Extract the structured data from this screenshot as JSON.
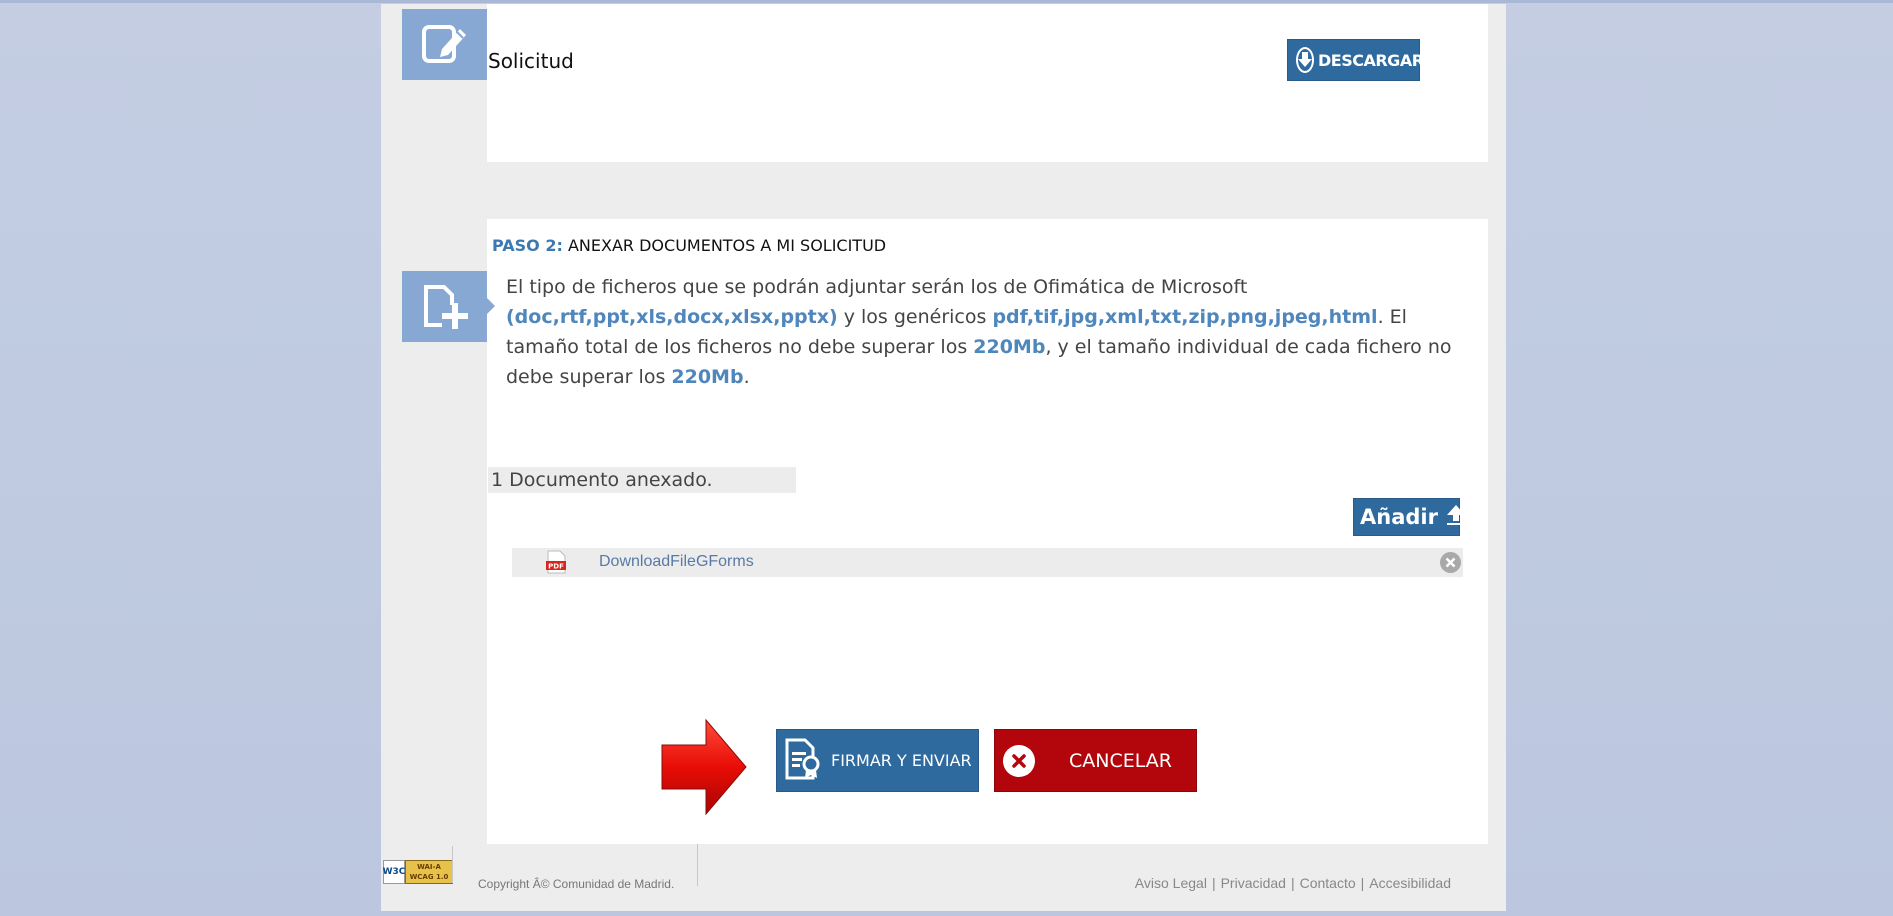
{
  "step1": {
    "title": "Solicitud",
    "download_label": "DESCARGAR"
  },
  "step2": {
    "step_label": "PASO 2:",
    "step_title": "ANEXAR DOCUMENTOS A MI SOLICITUD",
    "desc": {
      "t1": "El tipo de ficheros que se podrán adjuntar serán los de Ofimática de Microsoft ",
      "h1": "(doc,rtf,ppt,xls,docx,xlsx,pptx)",
      "t2": " y los genéricos ",
      "h2": "pdf,tif,jpg,xml,txt,zip,png,jpeg,html",
      "t3": ". El tamaño total de los ficheros no debe superar los ",
      "h3": "220Mb",
      "t4": ", y el tamaño individual de cada fichero no debe superar los ",
      "h4": "220Mb",
      "t5": "."
    },
    "doc_count": "1 Documento anexado.",
    "add_label": "Añadir",
    "files": [
      {
        "name": "DownloadFileGForms",
        "type": "PDF"
      }
    ]
  },
  "actions": {
    "sign_label": "FIRMAR Y ENVIAR",
    "cancel_label": "CANCELAR"
  },
  "footer": {
    "badge_w3c": "W3C",
    "badge_wai": "WAI-A",
    "badge_wcag": "WCAG 1.0",
    "copyright": "Copyright Â© Comunidad de Madrid.",
    "links": [
      "Aviso Legal",
      "Privacidad",
      "Contacto",
      "Accesibilidad"
    ]
  },
  "colors": {
    "primary": "#2f6a9f",
    "danger": "#b3060c",
    "highlight": "#4f86bb",
    "icon_bg": "#87a8d3"
  }
}
